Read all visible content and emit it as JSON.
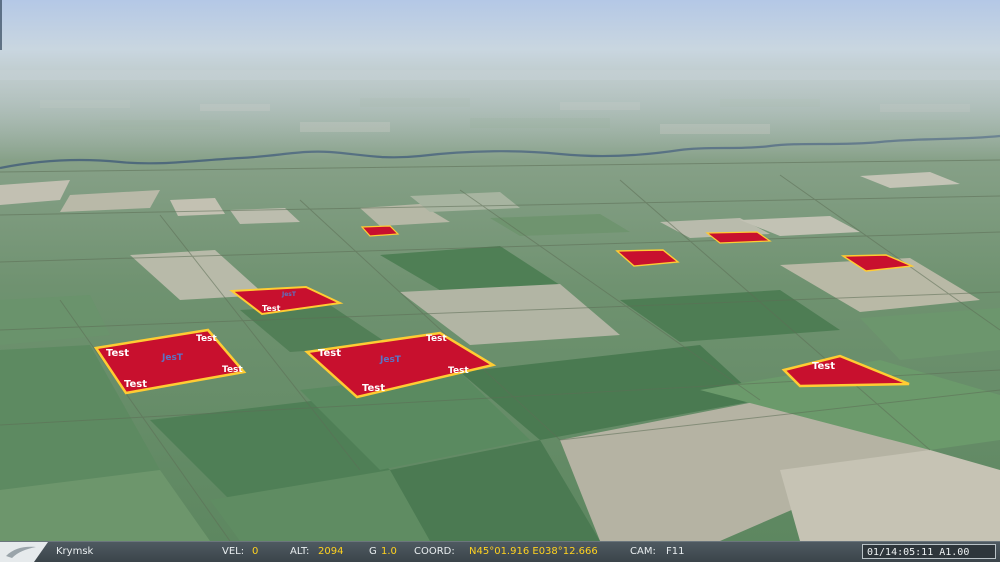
{
  "status": {
    "location": "Krymsk",
    "vel_label": "VEL:",
    "vel_value": "0",
    "alt_label": "ALT:",
    "alt_value": "2094",
    "g_label": "G",
    "g_value": "1.0",
    "coord_label": "COORD:",
    "coord_value": "N45°01.916 E038°12.666",
    "cam_label": "CAM:",
    "cam_value": "F11",
    "time": "01/14:05:11 A1.00"
  },
  "zones": {
    "test_label": "Test",
    "jest_label": "JesT"
  },
  "colors": {
    "zone_fill": "#c8102e",
    "zone_border": "#ffcc33",
    "value_yellow": "#ffd21f",
    "sky_top": "#b4c8e6",
    "field_green": "#5f8a5e"
  }
}
